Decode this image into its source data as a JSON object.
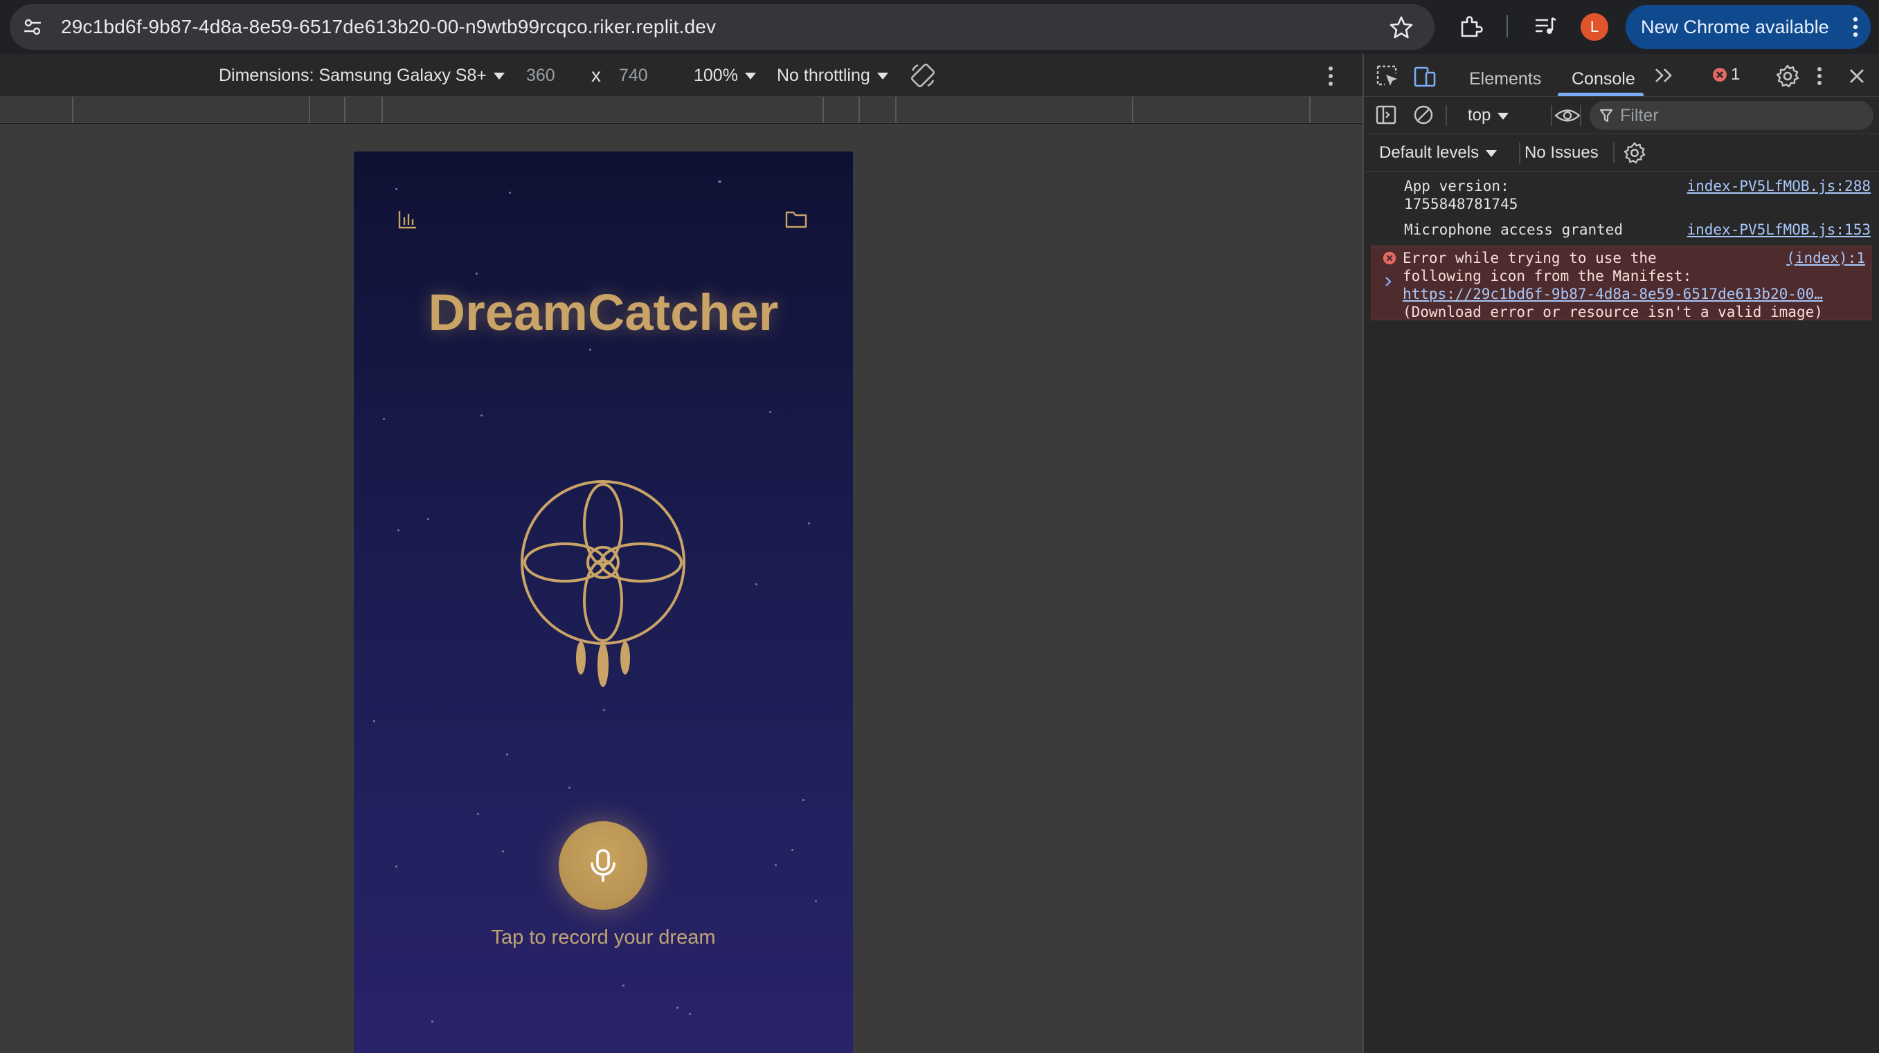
{
  "browser": {
    "url": "29c1bd6f-9b87-4d8a-8e59-6517de613b20-00-n9wtb99rcqco.riker.replit.dev",
    "profile_initial": "L",
    "new_chrome_label": "New Chrome available",
    "colors": {
      "accent": "#104a8e",
      "profile": "#e0542b"
    }
  },
  "device_toolbar": {
    "dimensions_label": "Dimensions: Samsung Galaxy S8+",
    "width": "360",
    "times": "x",
    "height": "740",
    "zoom": "100%",
    "throttling": "No throttling"
  },
  "app": {
    "title": "DreamCatcher",
    "record_hint": "Tap to record your dream",
    "icons": [
      "stats-icon",
      "folder-icon",
      "dreamcatcher-logo",
      "microphone-icon"
    ],
    "colors": {
      "gold": "#c9a466",
      "bg_top": "#0f1133",
      "bg_bottom": "#29236a"
    }
  },
  "devtools": {
    "tabs": {
      "elements": "Elements",
      "console": "Console"
    },
    "error_count": "1",
    "context": "top",
    "filter_placeholder": "Filter",
    "levels": "Default levels",
    "issues": "No Issues",
    "messages": [
      {
        "text_line1": "App version:",
        "text_line2": "1755848781745",
        "source": "index-PV5LfMOB.js:288"
      },
      {
        "text_line1": "Microphone access granted",
        "source": "index-PV5LfMOB.js:153"
      },
      {
        "level": "error",
        "text_line1": "Error while trying to use the",
        "text_line2": "following icon from the Manifest:",
        "link": "https://29c1bd6f-9b87-4d8a-8e59-6517de613b20-00…",
        "text_line4": "(Download error or resource isn't a valid image)",
        "source": "(index):1"
      }
    ]
  }
}
